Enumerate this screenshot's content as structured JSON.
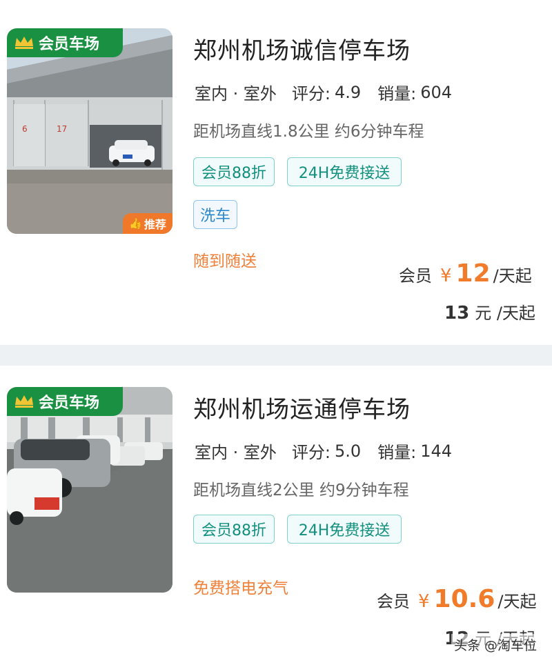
{
  "listings": [
    {
      "badge": "会员车场",
      "recommend": "推荐",
      "title": "郑州机场诚信停车场",
      "indoor_outdoor": "室内 · 室外",
      "rating_label": "评分:",
      "rating": "4.9",
      "sales_label": "销量:",
      "sales": "604",
      "distance": "距机场直线1.8公里 约6分钟车程",
      "tags": [
        "会员88折",
        "24H免费接送",
        "洗车"
      ],
      "service": "随到随送",
      "member_label": "会员",
      "currency": "¥",
      "member_price": "12",
      "price_unit": "/天起",
      "normal_price": "13",
      "normal_unit": "元 /天起"
    },
    {
      "badge": "会员车场",
      "title": "郑州机场运通停车场",
      "indoor_outdoor": "室内 · 室外",
      "rating_label": "评分:",
      "rating": "5.0",
      "sales_label": "销量:",
      "sales": "144",
      "distance": "距机场直线2公里 约9分钟车程",
      "tags": [
        "会员88折",
        "24H免费接送"
      ],
      "service": "免费搭电充气",
      "member_label": "会员",
      "currency": "¥",
      "member_price": "10.6",
      "price_unit": "/天起",
      "normal_price": "12",
      "normal_unit": "元 /天起"
    }
  ],
  "watermark": "头条 @淘车位",
  "colors": {
    "member_green": "#1a9142",
    "price_orange": "#f07c2b",
    "chip_teal": "#12907e",
    "chip_blue": "#2a87cc"
  }
}
